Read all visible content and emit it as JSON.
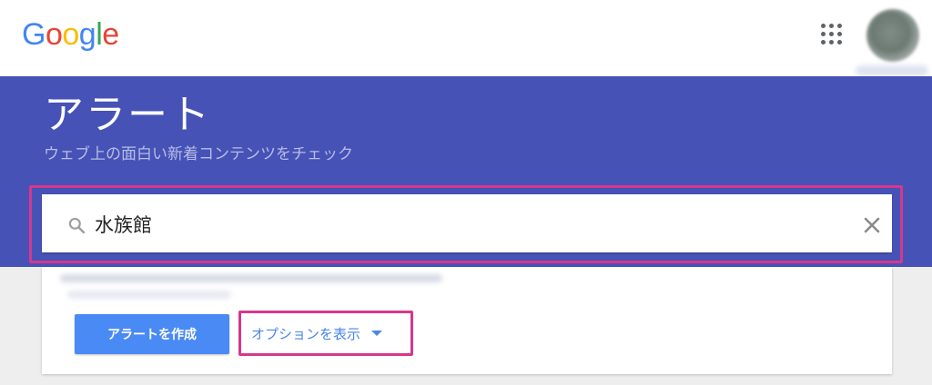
{
  "header": {
    "logo": {
      "letters": [
        {
          "char": "G",
          "color": "#4285F4"
        },
        {
          "char": "o",
          "color": "#EA4335"
        },
        {
          "char": "o",
          "color": "#FBBC05"
        },
        {
          "char": "g",
          "color": "#4285F4"
        },
        {
          "char": "l",
          "color": "#34A853"
        },
        {
          "char": "e",
          "color": "#EA4335"
        }
      ]
    },
    "apps_icon": "apps-grid-icon",
    "avatar_icon": "account-avatar"
  },
  "banner": {
    "title": "アラート",
    "subtitle": "ウェブ上の面白い新着コンテンツをチェック",
    "color": "#4652B6"
  },
  "search": {
    "value": "水族館",
    "search_icon": "search-icon",
    "clear_icon": "close-icon"
  },
  "actions": {
    "create_label": "アラートを作成",
    "options_label": "オプションを表示",
    "options_icon": "caret-down-icon",
    "primary_color": "#4A8AF4",
    "highlight_color": "#D6378D"
  }
}
